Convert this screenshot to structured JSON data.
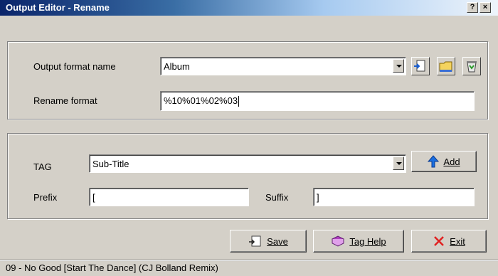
{
  "window": {
    "title": "Output Editor - Rename",
    "help_label": "?",
    "close_label": "×"
  },
  "format": {
    "name_label": "Output format name",
    "name_value": "Album",
    "rename_label": "Rename format",
    "rename_value": "%10%01%02%03"
  },
  "tag": {
    "tag_label": "TAG",
    "tag_value": "Sub-Title",
    "add_label": "Add",
    "prefix_label": "Prefix",
    "prefix_value": "[",
    "suffix_label": "Suffix",
    "suffix_value": "]"
  },
  "buttons": {
    "save": "Save",
    "tag_help": "Tag Help",
    "exit": "Exit"
  },
  "status": {
    "text": "09 - No Good [Start The Dance] (CJ Bolland Remix)"
  }
}
